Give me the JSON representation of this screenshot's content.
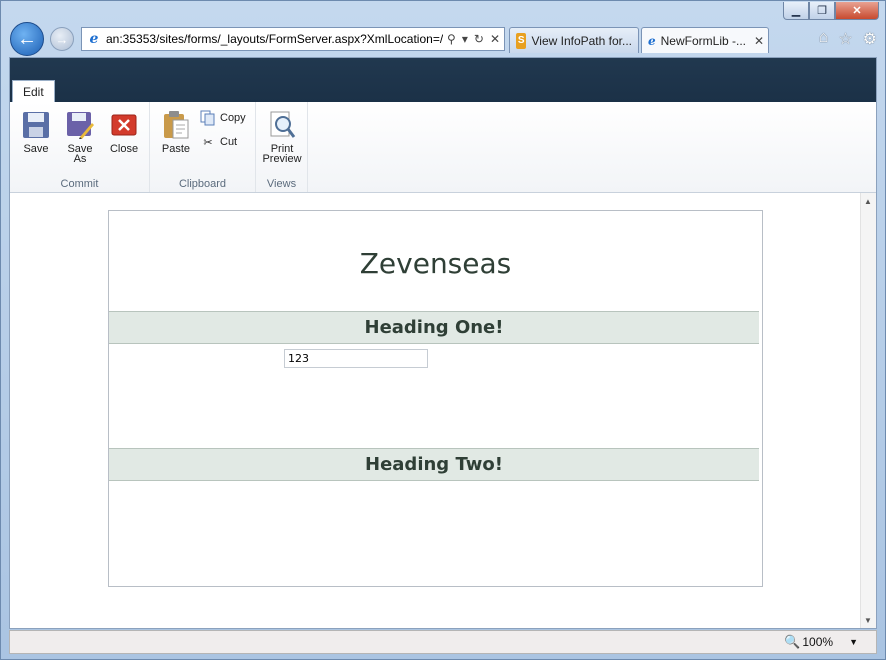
{
  "browser": {
    "address": "an:35353/sites/forms/_layouts/FormServer.aspx?XmlLocation=/",
    "tabs": [
      {
        "label": "View InfoPath for..."
      },
      {
        "label": "NewFormLib -...",
        "close": "✕"
      }
    ]
  },
  "ribbon": {
    "tab_edit": "Edit",
    "groups": {
      "commit": "Commit",
      "clipboard": "Clipboard",
      "views": "Views"
    },
    "buttons": {
      "save": "Save",
      "save_as_line1": "Save",
      "save_as_line2": "As",
      "close": "Close",
      "paste": "Paste",
      "copy": "Copy",
      "cut": "Cut",
      "print_preview_line1": "Print",
      "print_preview_line2": "Preview"
    }
  },
  "form": {
    "title": "Zevenseas",
    "section1": "Heading One!",
    "section2": "Heading Two!",
    "field_value": "123"
  },
  "status": {
    "zoom": "100%"
  },
  "colors": {
    "ribbon_dark": "#1b3147",
    "section_bg": "#e1e9e4",
    "title_text": "#2f3f36"
  }
}
